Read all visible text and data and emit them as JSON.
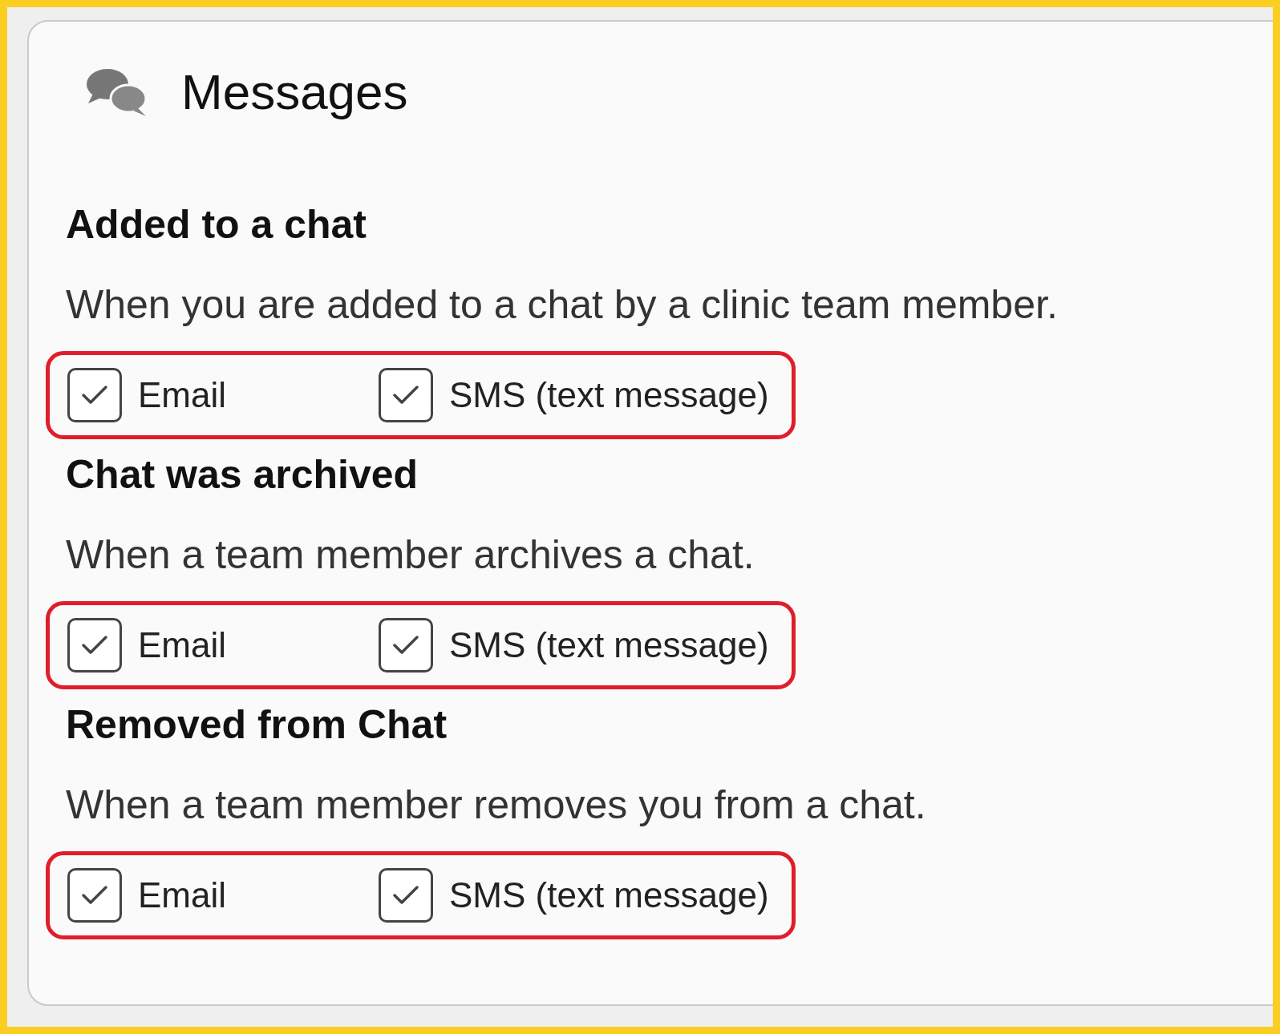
{
  "panel": {
    "title": "Messages"
  },
  "sections": [
    {
      "heading": "Added to a chat",
      "description": "When you are added to a chat by a clinic team member.",
      "highlighted": true,
      "options": [
        {
          "label": "Email",
          "checked": true
        },
        {
          "label": "SMS (text message)",
          "checked": true
        }
      ]
    },
    {
      "heading": "Chat was archived",
      "description": "When a team member archives a chat.",
      "highlighted": true,
      "options": [
        {
          "label": "Email",
          "checked": true
        },
        {
          "label": "SMS (text message)",
          "checked": true
        }
      ]
    },
    {
      "heading": "Removed from Chat",
      "description": "When a team member removes you from a chat.",
      "highlighted": true,
      "options": [
        {
          "label": "Email",
          "checked": true
        },
        {
          "label": "SMS (text message)",
          "checked": true
        }
      ]
    }
  ]
}
